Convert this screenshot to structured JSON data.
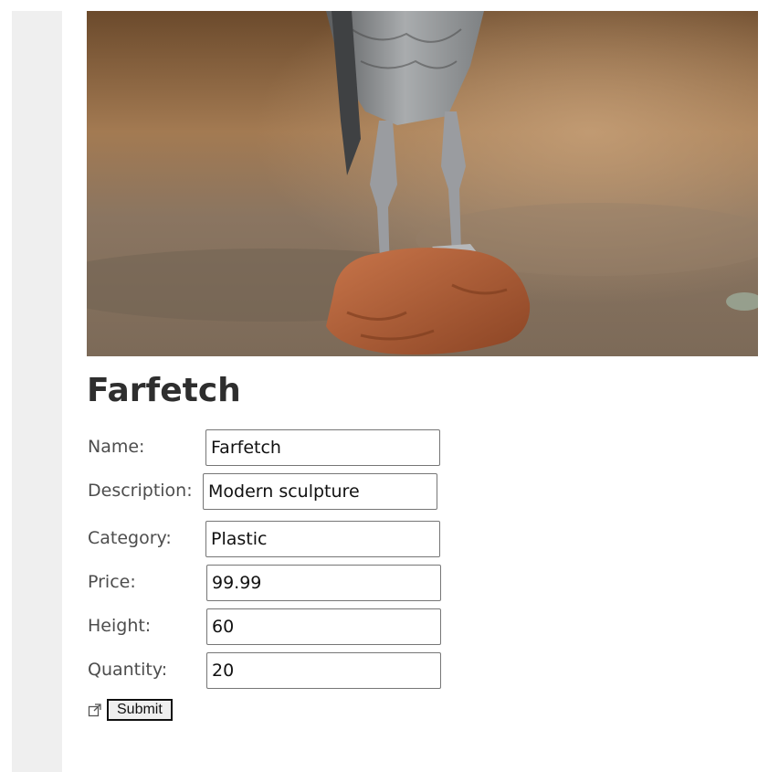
{
  "product": {
    "title": "Farfetch",
    "image_alt": "Carved wooden bird sculpture on a base"
  },
  "form": {
    "fields": [
      {
        "label": "Name:",
        "value": "Farfetch"
      },
      {
        "label": "Description:",
        "value": "Modern sculpture"
      },
      {
        "label": "Category:",
        "value": "Plastic"
      },
      {
        "label": "Price:",
        "value": "99.99"
      },
      {
        "label": "Height:",
        "value": "60"
      },
      {
        "label": "Quantity:",
        "value": "20"
      }
    ],
    "submit_label": "Submit",
    "external_icon": "external-link-icon"
  }
}
